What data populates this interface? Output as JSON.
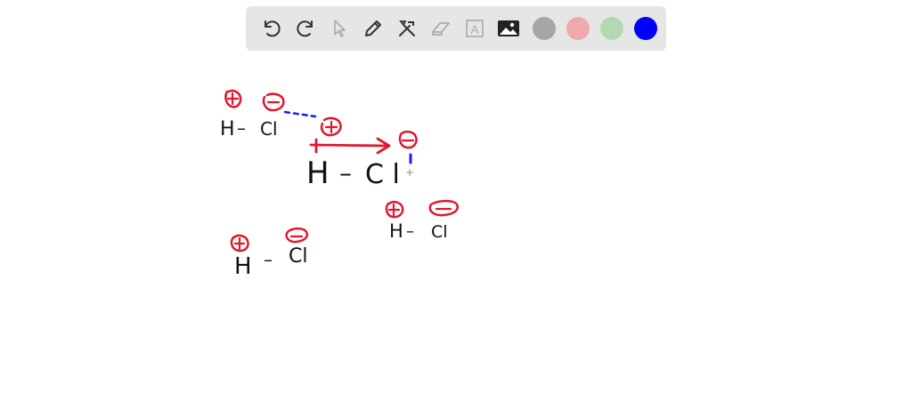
{
  "toolbar": {
    "tools": [
      {
        "name": "undo-icon",
        "enabled": true
      },
      {
        "name": "redo-icon",
        "enabled": true
      },
      {
        "name": "pointer-icon",
        "enabled": false
      },
      {
        "name": "pen-icon",
        "enabled": true
      },
      {
        "name": "tools-icon",
        "enabled": true
      },
      {
        "name": "eraser-icon",
        "enabled": false
      },
      {
        "name": "text-icon",
        "enabled": false
      },
      {
        "name": "image-icon",
        "enabled": true
      }
    ],
    "text_tool_glyph": "A",
    "colors": [
      "#a6a6a6",
      "#f0a8ad",
      "#b3d9b3",
      "#0000ff"
    ],
    "selected_color": "#0000ff"
  },
  "board": {
    "ink_red": "#e0182d",
    "ink_blue": "#1a1aff",
    "ink_black": "#111111",
    "molecules": [
      {
        "h": "H",
        "bond": "–",
        "cl": "Cl"
      },
      {
        "h": "H",
        "bond": "–",
        "cl": "C l"
      },
      {
        "h": "H",
        "bond": "–",
        "cl": "Cl"
      },
      {
        "h": "H",
        "bond": "–",
        "cl": "Cl"
      }
    ],
    "plus": "+",
    "minus": "−"
  }
}
